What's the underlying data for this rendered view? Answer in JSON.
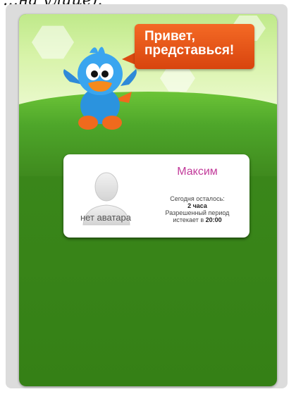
{
  "page": {
    "corner_text": "…на улице)."
  },
  "header": {
    "greeting_line1": "Привет,",
    "greeting_line2": "представься!"
  },
  "user_card": {
    "name": "Максим",
    "no_avatar_label": "нет аватара",
    "remaining_label": "Сегодня осталось:",
    "remaining_value": "2 часа",
    "period_label": "Разрешенный период",
    "expires_prefix": "истекает в",
    "expires_time": "20:00"
  },
  "colors": {
    "panel_green": "#3f8a1e",
    "bubble_orange": "#e6561a",
    "name_magenta": "#c23a9a"
  },
  "icons": [
    "mascot-bird-icon",
    "user-silhouette-icon"
  ]
}
